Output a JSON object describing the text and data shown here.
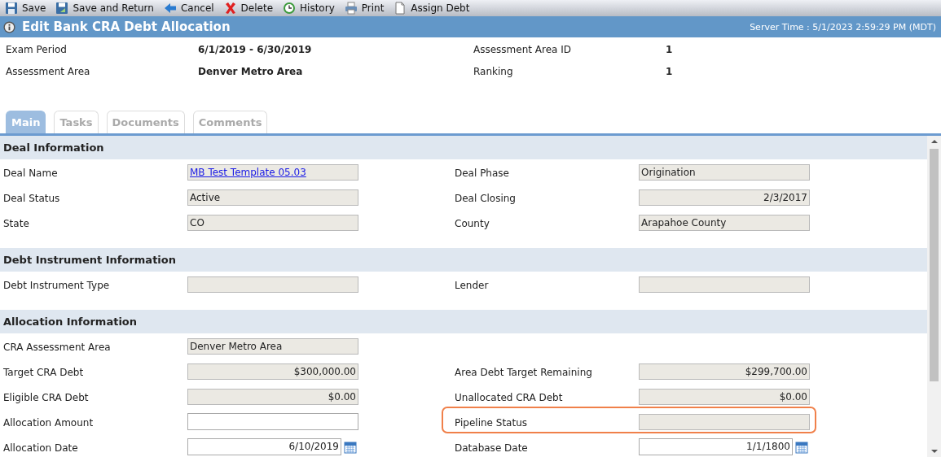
{
  "toolbar": [
    {
      "label": "Save"
    },
    {
      "label": "Save and Return"
    },
    {
      "label": "Cancel"
    },
    {
      "label": "Delete"
    },
    {
      "label": "History"
    },
    {
      "label": "Print"
    },
    {
      "label": "Assign Debt"
    }
  ],
  "title": "Edit Bank CRA Debt Allocation",
  "server_time": "Server Time : 5/1/2023 2:59:29 PM (MDT)",
  "summary": [
    {
      "label": "Exam Period",
      "value": "6/1/2019 - 6/30/2019"
    },
    {
      "label": "Assessment Area ID",
      "value": "1"
    },
    {
      "label": "Assessment Area",
      "value": "Denver Metro Area"
    },
    {
      "label": "Ranking",
      "value": "1"
    }
  ],
  "tabs": [
    {
      "label": "Main",
      "selected": true
    },
    {
      "label": "Tasks",
      "selected": false
    },
    {
      "label": "Documents",
      "selected": false
    },
    {
      "label": "Comments",
      "selected": false
    }
  ],
  "sections": [
    {
      "title": "Deal Information",
      "rows": [
        [
          {
            "label": "Deal Name",
            "kind": "link",
            "value": "MB Test Template 05.03"
          },
          {
            "label": "Deal Phase",
            "kind": "text",
            "value": "Origination"
          }
        ],
        [
          {
            "label": "Deal Status",
            "kind": "text",
            "value": "Active"
          },
          {
            "label": "Deal Closing",
            "kind": "amount",
            "value": "2/3/2017"
          }
        ],
        [
          {
            "label": "State",
            "kind": "text",
            "value": "CO"
          },
          {
            "label": "County",
            "kind": "text",
            "value": "Arapahoe County"
          }
        ]
      ]
    },
    {
      "title": "Debt Instrument Information",
      "rows": [
        [
          {
            "label": "Debt Instrument Type",
            "kind": "text"
          },
          {
            "label": "Lender",
            "kind": "text"
          }
        ]
      ]
    },
    {
      "title": "Allocation Information",
      "rows": [
        [
          {
            "label": "CRA Assessment Area",
            "kind": "text",
            "value": "Denver Metro Area"
          }
        ],
        [
          {
            "label": "Target CRA Debt",
            "kind": "amount",
            "value": "$300,000.00"
          },
          {
            "label": "Area Debt Target Remaining",
            "kind": "amount",
            "value": "$299,700.00"
          }
        ],
        [
          {
            "label": "Eligible CRA Debt",
            "kind": "amount",
            "value": "$0.00"
          },
          {
            "label": "Unallocated CRA Debt",
            "kind": "amount",
            "value": "$0.00"
          }
        ],
        [
          {
            "label": "Allocation Amount",
            "kind": "input"
          },
          {
            "label": "Pipeline Status",
            "kind": "text",
            "highlighted": true
          }
        ],
        [
          {
            "label": "Allocation Date",
            "kind": "date",
            "value": "6/10/2019"
          },
          {
            "label": "Database Date",
            "kind": "date",
            "value": "1/1/1800"
          }
        ]
      ]
    }
  ]
}
